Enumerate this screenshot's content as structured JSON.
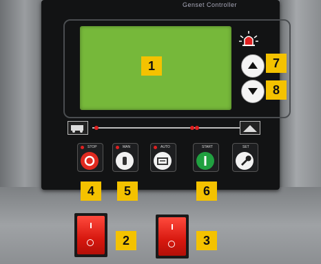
{
  "panel": {
    "brand": "Genset Controller"
  },
  "callouts": {
    "n1": "1",
    "n2": "2",
    "n3": "3",
    "n4": "4",
    "n5": "5",
    "n6": "6",
    "n7": "7",
    "n8": "8"
  },
  "keys": [
    {
      "label": "STOP",
      "icon": "stop-icon",
      "color": "#e02a20"
    },
    {
      "label": "MAN",
      "icon": "hand-icon",
      "color": "#f2f2f2"
    },
    {
      "label": "AUTO",
      "icon": "auto-icon",
      "color": "#f2f2f2"
    },
    {
      "label": "START",
      "icon": "start-icon",
      "color": "#20a040"
    },
    {
      "label": "SET",
      "icon": "wrench-icon",
      "color": "#f2f2f2"
    }
  ],
  "colors": {
    "callout": "#f4c200",
    "lcd": "#76b83a",
    "switch": "#e0231a"
  }
}
